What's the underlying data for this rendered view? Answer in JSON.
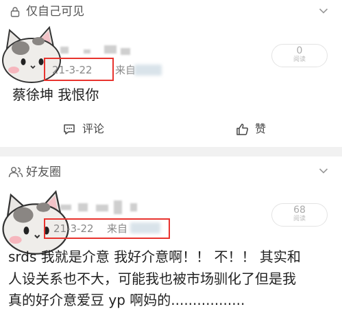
{
  "post1": {
    "visibility_label": "仅自己可见",
    "date": "21-3-22",
    "source_prefix": "来自",
    "read_count": "0",
    "read_label": "阅读",
    "text": "蔡徐坤 我恨你",
    "comment_label": "评论",
    "like_label": "赞"
  },
  "post2": {
    "visibility_label": "好友圈",
    "date": "21-3-22",
    "source_prefix": "来自",
    "read_count": "68",
    "read_label": "阅读",
    "text_lines": [
      "srds 我就是介意 我好介意啊！！ 不！！ 其实和",
      "人设关系也不大，可能我也被市场驯化了但是我",
      "真的好介意爱豆 yp 啊妈的................."
    ]
  },
  "colors": {
    "highlight_box": "#e8322d",
    "divider": "#f1f1f1",
    "secondary_text": "#888888"
  },
  "icons": [
    "lock-icon",
    "friends-icon",
    "chevron-down-icon",
    "comment-icon",
    "like-icon",
    "cat-avatar"
  ]
}
